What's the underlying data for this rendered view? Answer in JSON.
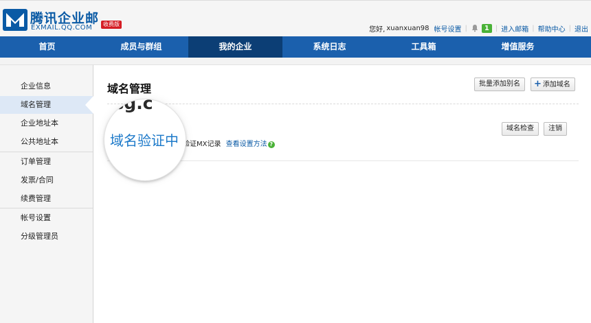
{
  "header": {
    "brand_cn": "腾讯企业邮",
    "brand_en": "EXMAIL.QQ.COM",
    "edition_badge": "收费版",
    "greeting": "您好,",
    "username": "xuanxuan98",
    "account_settings": "帐号设置",
    "notification_count": "1",
    "enter_mailbox": "进入邮箱",
    "help_center": "帮助中心",
    "logout": "退出",
    "brand_color": "#0a5aa5",
    "badge_color": "#d51d24",
    "notice_color": "#4ab237"
  },
  "nav": {
    "color": "#1b60ad",
    "active_color": "#0c3e75",
    "items": [
      "首页",
      "成员与群组",
      "我的企业",
      "系统日志",
      "工具箱",
      "增值服务"
    ],
    "active": "我的企业"
  },
  "sidebar": {
    "active": "域名管理",
    "items": [
      "企业信息",
      "域名管理",
      "企业地址本",
      "公共地址本",
      "订单管理",
      "发票/合同",
      "续费管理",
      "帐号设置",
      "分级管理员"
    ]
  },
  "main": {
    "title": "域名管理",
    "batch_alias_button": "批量添加别名",
    "add_domain_button": "添加域名",
    "domain_partial": ".sg.c",
    "domain_status": "域名验证中",
    "status_note_partial": "验证MX记录",
    "help_link": "查看设置方法",
    "help_icon_glyph": "?",
    "check_button": "域名检查",
    "cancel_button": "注销",
    "status_color": "#1c79c9"
  }
}
